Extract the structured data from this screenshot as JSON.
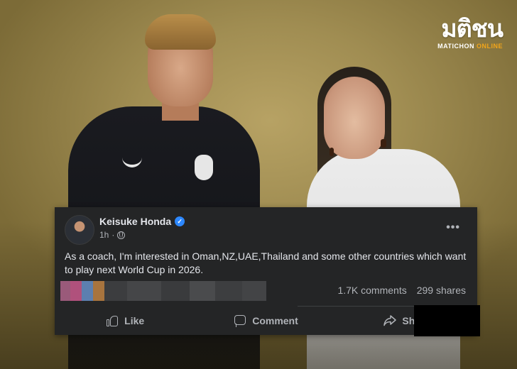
{
  "watermark": {
    "mark": "มติชน",
    "sub_a": "MATICHON",
    "sub_b": "ONLINE"
  },
  "post": {
    "author": "Keisuke Honda",
    "verified_icon": "verified-badge-icon",
    "timestamp": "1h",
    "audience_icon": "globe-icon",
    "more_label": "•••",
    "text": "As a coach, I'm interested in Oman,NZ,UAE,Thailand and some other countries which want to play next World Cup in 2026.",
    "comments": "1.7K comments",
    "shares": "299 shares",
    "reaction_blur_colors": [
      "#9a5a7a",
      "#b0517c",
      "#5c7fb0",
      "#a8743e",
      "#3c3d3f",
      "#454648",
      "#3a3b3d",
      "#4a4b4d",
      "#3d3e40",
      "#434446"
    ]
  },
  "actions": [
    {
      "label": "Like",
      "icon": "thumbs-up-icon"
    },
    {
      "label": "Comment",
      "icon": "comment-icon"
    },
    {
      "label": "Share",
      "icon": "share-icon"
    }
  ],
  "colors": {
    "card_bg": "#242526",
    "text_primary": "#e4e6eb",
    "text_secondary": "#b0b3b8",
    "verified": "#2d88ff",
    "logo_accent": "#f2a51a"
  }
}
